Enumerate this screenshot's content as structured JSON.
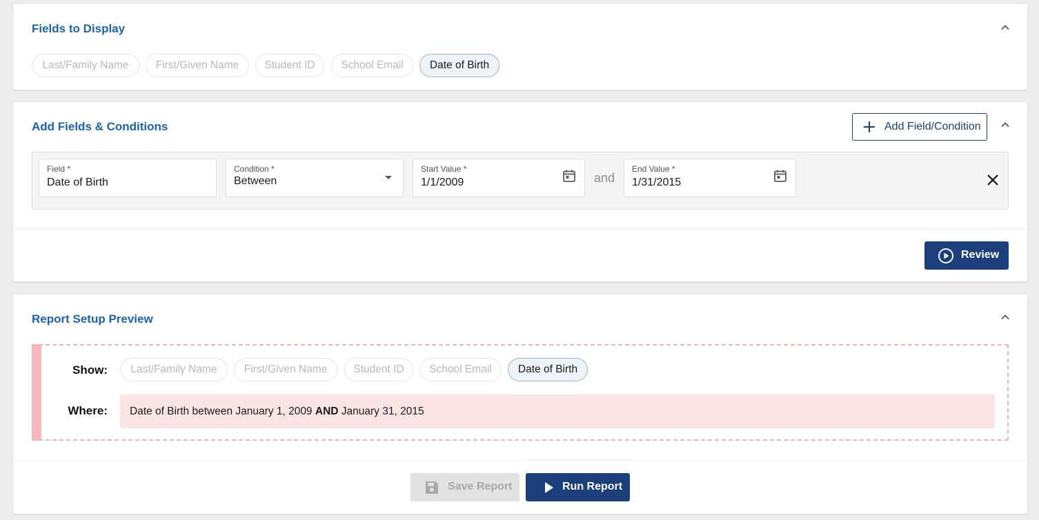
{
  "fields_to_display": {
    "title": "Fields to Display",
    "chips": [
      {
        "label": "Last/Family Name",
        "selected": false
      },
      {
        "label": "First/Given Name",
        "selected": false
      },
      {
        "label": "Student ID",
        "selected": false
      },
      {
        "label": "School Email",
        "selected": false
      },
      {
        "label": "Date of Birth",
        "selected": true
      }
    ]
  },
  "add_fields": {
    "title": "Add Fields & Conditions",
    "add_button_label": "Add Field/Condition",
    "condition": {
      "field_label": "Field *",
      "field_value": "Date of Birth",
      "condition_label": "Condition *",
      "condition_value": "Between",
      "start_label": "Start Value *",
      "start_value": "1/1/2009",
      "and_text": "and",
      "end_label": "End Value *",
      "end_value": "1/31/2015"
    },
    "review_button_label": "Review"
  },
  "report_preview": {
    "title": "Report Setup Preview",
    "show_label": "Show:",
    "where_label": "Where:",
    "where_field": "Date of Birth",
    "where_between": "between",
    "where_start": "January 1, 2009",
    "where_and": "AND",
    "where_end": "January 31, 2015"
  },
  "footer": {
    "save_label": "Save Report",
    "run_label": "Run Report"
  },
  "colors": {
    "accent": "#1a3f7a",
    "title_blue": "#1b63b0",
    "preview_pink": "#fbe4e4"
  }
}
